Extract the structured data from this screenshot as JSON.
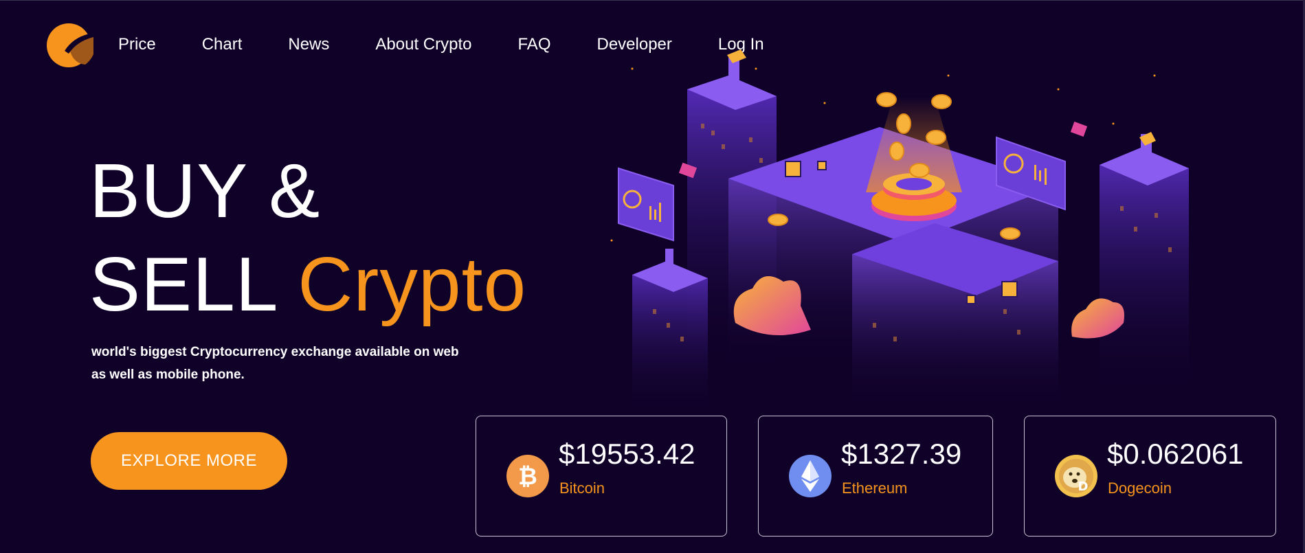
{
  "nav": {
    "items": [
      "Price",
      "Chart",
      "News",
      "About Crypto",
      "FAQ",
      "Developer",
      "Log In"
    ]
  },
  "hero": {
    "title_line1": "BUY &",
    "title_line2_white": "SELL",
    "title_line2_accent": "Crypto",
    "subtitle_line1": "world's biggest Cryptocurrency exchange available on web",
    "subtitle_line2": "as well as mobile phone.",
    "cta_label": "EXPLORE MORE"
  },
  "cards": [
    {
      "price": "$19553.42",
      "name": "Bitcoin",
      "icon": "bitcoin-icon"
    },
    {
      "price": "$1327.39",
      "name": "Ethereum",
      "icon": "ethereum-icon"
    },
    {
      "price": "$0.062061",
      "name": "Dogecoin",
      "icon": "dogecoin-icon"
    }
  ],
  "colors": {
    "background": "#100129",
    "accent": "#f7941d",
    "purple": "#6a3fd8",
    "text": "#ffffff"
  }
}
